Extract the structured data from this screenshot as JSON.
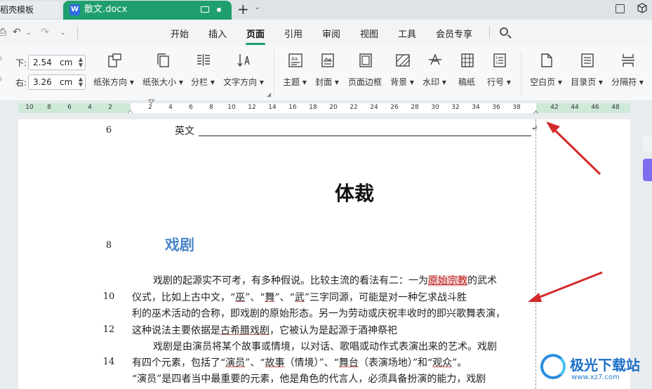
{
  "tabs": {
    "inactive_label": "稻壳模板",
    "active_label": "散文.docx",
    "active_icon_letter": "W"
  },
  "menu": {
    "items": [
      "开始",
      "插入",
      "页面",
      "引用",
      "审阅",
      "视图",
      "工具",
      "会员专享"
    ],
    "active": "页面"
  },
  "ribbon": {
    "margin_bottom_label": "下:",
    "margin_bottom_value": "2.54",
    "margin_right_label": "右:",
    "margin_right_value": "3.26",
    "unit": "cm",
    "buttons": [
      {
        "label": "纸张方向",
        "icon": "page-orientation-icon"
      },
      {
        "label": "纸张大小",
        "icon": "page-size-icon"
      },
      {
        "label": "分栏",
        "icon": "columns-icon"
      },
      {
        "label": "文字方向",
        "icon": "text-direction-icon"
      },
      {
        "label": "主题",
        "icon": "theme-icon"
      },
      {
        "label": "封面",
        "icon": "cover-icon"
      },
      {
        "label": "页面边框",
        "icon": "page-border-icon"
      },
      {
        "label": "背景",
        "icon": "background-icon"
      },
      {
        "label": "水印",
        "icon": "watermark-icon"
      },
      {
        "label": "稿纸",
        "icon": "manuscript-icon"
      },
      {
        "label": "行号",
        "icon": "line-number-icon"
      },
      {
        "label": "空白页",
        "icon": "blank-page-icon"
      },
      {
        "label": "目录页",
        "icon": "toc-page-icon"
      },
      {
        "label": "分隔符",
        "icon": "separator-icon"
      }
    ]
  },
  "ruler": {
    "left_ticks": [
      "10",
      "8",
      "6",
      "4",
      "2"
    ],
    "center_ticks": [
      "2",
      "4",
      "6",
      "8",
      "10",
      "12",
      "14",
      "16",
      "18",
      "20",
      "22",
      "24",
      "26",
      "28",
      "30",
      "32",
      "34",
      "36",
      "38"
    ],
    "right_ticks": [
      "42",
      "44",
      "46",
      "48"
    ]
  },
  "document": {
    "line_numbers": [
      "6",
      "8",
      "10",
      "12",
      "14"
    ],
    "field_label": "英文",
    "title": "体裁",
    "heading": "戏剧",
    "p1_line1_pre": "戏剧的起源实不可考，有多种假说。比较主流的看法有二：一为",
    "p1_line1_hl": "原始宗教",
    "p1_line1_post": "的武术",
    "p1_line2_a": "仪式，比如上古中文，“",
    "p1_line2_w1": "巫",
    "p1_line2_b": "”、“",
    "p1_line2_w2": "舞",
    "p1_line2_c": "”、“",
    "p1_line2_w3": "武",
    "p1_line2_d": "”三字同源，可能是对一种乞求战斗胜",
    "p1_line3": "利的巫术活动的合称，即戏剧的原始形态。另一为劳动或庆祝丰收时的即兴歌舞表演，",
    "p1_line4_pre": "这种说法主要依据是",
    "p1_line4_link": "古希腊戏剧",
    "p1_line4_post": "，它被认为是起源于酒神祭祀",
    "p2_line1": "戏剧是由演员将某个故事或情境，以对话、歌唱或动作式表演出来的艺术。戏剧",
    "p2_line2_a": "有四个元素，包括了“",
    "p2_line2_l1": "演员",
    "p2_line2_b": "”、“",
    "p2_line2_l2": "故事",
    "p2_line2_c": "（情境）”、“",
    "p2_line2_l3": "舞台",
    "p2_line2_d": "（表演场地）”和“",
    "p2_line2_l4": "观众",
    "p2_line2_e": "”。",
    "p2_line3": "“演员”是四者当中最重要的元素，他是角色的代言人，必须具备扮演的能力，戏剧"
  },
  "watermark": {
    "brand": "极光下载站",
    "url": "www.xz7.com"
  },
  "colors": {
    "accent_green": "#1f9f6e",
    "heading_blue": "#4a86c8",
    "arrow_red": "#d42a2a"
  }
}
